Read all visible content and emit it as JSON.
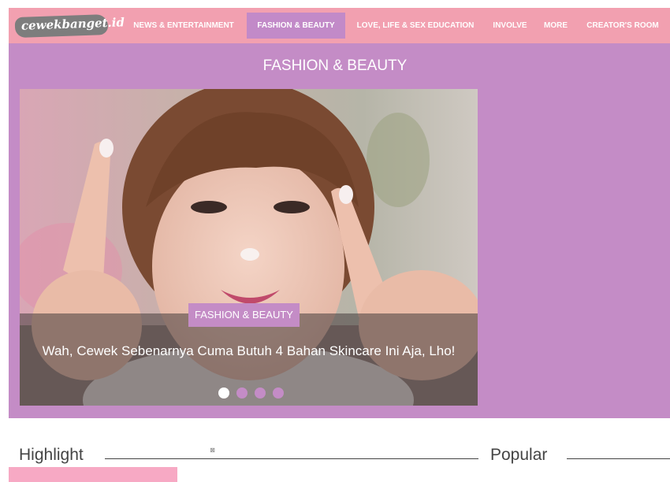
{
  "logo": {
    "text": "cewekbanget.id"
  },
  "nav": {
    "items": [
      {
        "label": "NEWS & ENTERTAINMENT"
      },
      {
        "label": "FASHION & BEAUTY"
      },
      {
        "label": "LOVE, LIFE & SEX EDUCATION"
      },
      {
        "label": "INVOLVE"
      },
      {
        "label": "MORE"
      },
      {
        "label": "CREATOR'S ROOM"
      }
    ],
    "active_index": 1
  },
  "section": {
    "title": "FASHION & BEAUTY"
  },
  "slider": {
    "badge": "FASHION & BEAUTY",
    "title": "Wah, Cewek Sebenarnya Cuma Butuh 4 Bahan Skincare Ini Aja, Lho!",
    "dot_count": 4,
    "active_dot": 0
  },
  "headings": {
    "highlight": "Highlight",
    "popular": "Popular"
  },
  "colors": {
    "nav_bg": "#f2a0b0",
    "accent_purple": "#c48cc6",
    "pink_block": "#f7a9c4"
  },
  "icons": {
    "ad_close": "close-icon"
  }
}
